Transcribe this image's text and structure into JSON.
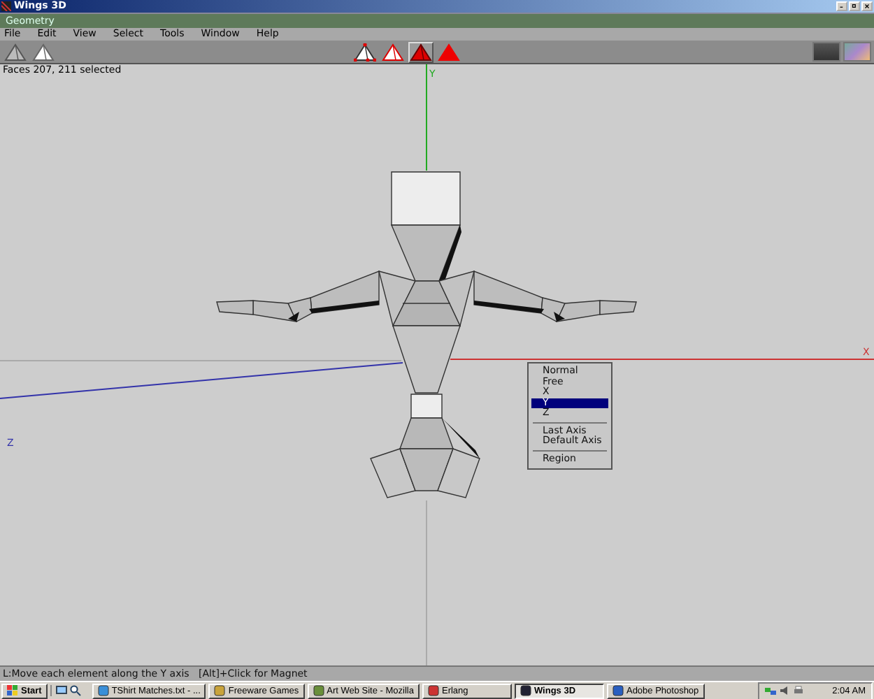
{
  "window": {
    "title": "Wings 3D"
  },
  "geometry_bar": {
    "title": "Geometry"
  },
  "menu": [
    "File",
    "Edit",
    "View",
    "Select",
    "Tools",
    "Window",
    "Help"
  ],
  "view_buttons": [
    {
      "kind": "solid"
    },
    {
      "kind": "shaded"
    }
  ],
  "select_modes": [
    {
      "kind": "vertex",
      "selected": false
    },
    {
      "kind": "edge",
      "selected": false
    },
    {
      "kind": "face",
      "selected": true
    },
    {
      "kind": "body",
      "selected": false
    }
  ],
  "info": "Faces 207, 211 selected",
  "axes": {
    "x": "X",
    "y": "Y",
    "z": "Z"
  },
  "context_menu": [
    {
      "kind": "item",
      "label": "Normal",
      "selected": false
    },
    {
      "kind": "item",
      "label": "Free",
      "selected": false
    },
    {
      "kind": "item",
      "label": "X",
      "selected": false
    },
    {
      "kind": "item",
      "label": "Y",
      "selected": true
    },
    {
      "kind": "item",
      "label": "Z",
      "selected": false
    },
    {
      "kind": "separator"
    },
    {
      "kind": "item",
      "label": "Last Axis",
      "selected": false
    },
    {
      "kind": "item",
      "label": "Default Axis",
      "selected": false
    },
    {
      "kind": "separator"
    },
    {
      "kind": "item",
      "label": "Region",
      "selected": false
    }
  ],
  "status": "L:Move each element along the Y axis   [Alt]+Click for Magnet",
  "taskbar": {
    "start": "Start",
    "tasks": [
      {
        "label": "TShirt Matches.txt - ...",
        "selected": false
      },
      {
        "label": "Freeware Games",
        "selected": false
      },
      {
        "label": "Art Web Site - Mozilla",
        "selected": false
      },
      {
        "label": "Erlang",
        "selected": false
      },
      {
        "label": "Wings 3D",
        "selected": true
      },
      {
        "label": "Adobe Photoshop",
        "selected": false
      }
    ],
    "clock": "2:04 AM"
  }
}
